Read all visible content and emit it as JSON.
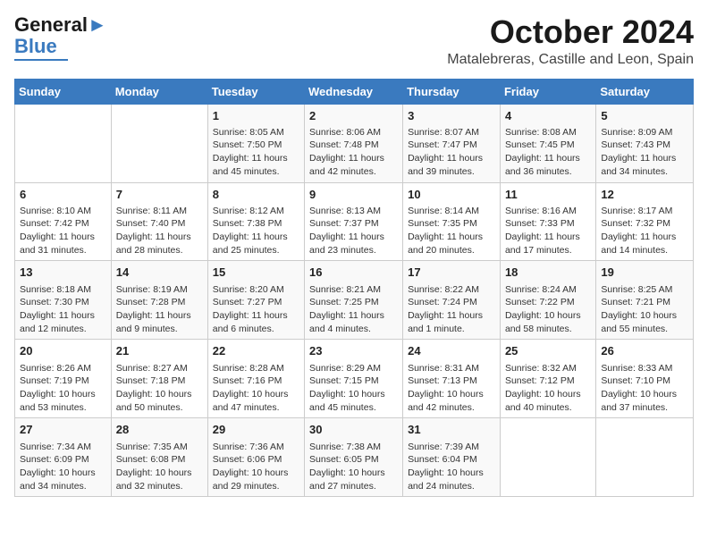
{
  "logo": {
    "line1": "General",
    "line2": "Blue"
  },
  "header": {
    "month": "October 2024",
    "location": "Matalebreras, Castille and Leon, Spain"
  },
  "days_of_week": [
    "Sunday",
    "Monday",
    "Tuesday",
    "Wednesday",
    "Thursday",
    "Friday",
    "Saturday"
  ],
  "weeks": [
    [
      {
        "day": "",
        "info": ""
      },
      {
        "day": "",
        "info": ""
      },
      {
        "day": "1",
        "info": "Sunrise: 8:05 AM\nSunset: 7:50 PM\nDaylight: 11 hours and 45 minutes."
      },
      {
        "day": "2",
        "info": "Sunrise: 8:06 AM\nSunset: 7:48 PM\nDaylight: 11 hours and 42 minutes."
      },
      {
        "day": "3",
        "info": "Sunrise: 8:07 AM\nSunset: 7:47 PM\nDaylight: 11 hours and 39 minutes."
      },
      {
        "day": "4",
        "info": "Sunrise: 8:08 AM\nSunset: 7:45 PM\nDaylight: 11 hours and 36 minutes."
      },
      {
        "day": "5",
        "info": "Sunrise: 8:09 AM\nSunset: 7:43 PM\nDaylight: 11 hours and 34 minutes."
      }
    ],
    [
      {
        "day": "6",
        "info": "Sunrise: 8:10 AM\nSunset: 7:42 PM\nDaylight: 11 hours and 31 minutes."
      },
      {
        "day": "7",
        "info": "Sunrise: 8:11 AM\nSunset: 7:40 PM\nDaylight: 11 hours and 28 minutes."
      },
      {
        "day": "8",
        "info": "Sunrise: 8:12 AM\nSunset: 7:38 PM\nDaylight: 11 hours and 25 minutes."
      },
      {
        "day": "9",
        "info": "Sunrise: 8:13 AM\nSunset: 7:37 PM\nDaylight: 11 hours and 23 minutes."
      },
      {
        "day": "10",
        "info": "Sunrise: 8:14 AM\nSunset: 7:35 PM\nDaylight: 11 hours and 20 minutes."
      },
      {
        "day": "11",
        "info": "Sunrise: 8:16 AM\nSunset: 7:33 PM\nDaylight: 11 hours and 17 minutes."
      },
      {
        "day": "12",
        "info": "Sunrise: 8:17 AM\nSunset: 7:32 PM\nDaylight: 11 hours and 14 minutes."
      }
    ],
    [
      {
        "day": "13",
        "info": "Sunrise: 8:18 AM\nSunset: 7:30 PM\nDaylight: 11 hours and 12 minutes."
      },
      {
        "day": "14",
        "info": "Sunrise: 8:19 AM\nSunset: 7:28 PM\nDaylight: 11 hours and 9 minutes."
      },
      {
        "day": "15",
        "info": "Sunrise: 8:20 AM\nSunset: 7:27 PM\nDaylight: 11 hours and 6 minutes."
      },
      {
        "day": "16",
        "info": "Sunrise: 8:21 AM\nSunset: 7:25 PM\nDaylight: 11 hours and 4 minutes."
      },
      {
        "day": "17",
        "info": "Sunrise: 8:22 AM\nSunset: 7:24 PM\nDaylight: 11 hours and 1 minute."
      },
      {
        "day": "18",
        "info": "Sunrise: 8:24 AM\nSunset: 7:22 PM\nDaylight: 10 hours and 58 minutes."
      },
      {
        "day": "19",
        "info": "Sunrise: 8:25 AM\nSunset: 7:21 PM\nDaylight: 10 hours and 55 minutes."
      }
    ],
    [
      {
        "day": "20",
        "info": "Sunrise: 8:26 AM\nSunset: 7:19 PM\nDaylight: 10 hours and 53 minutes."
      },
      {
        "day": "21",
        "info": "Sunrise: 8:27 AM\nSunset: 7:18 PM\nDaylight: 10 hours and 50 minutes."
      },
      {
        "day": "22",
        "info": "Sunrise: 8:28 AM\nSunset: 7:16 PM\nDaylight: 10 hours and 47 minutes."
      },
      {
        "day": "23",
        "info": "Sunrise: 8:29 AM\nSunset: 7:15 PM\nDaylight: 10 hours and 45 minutes."
      },
      {
        "day": "24",
        "info": "Sunrise: 8:31 AM\nSunset: 7:13 PM\nDaylight: 10 hours and 42 minutes."
      },
      {
        "day": "25",
        "info": "Sunrise: 8:32 AM\nSunset: 7:12 PM\nDaylight: 10 hours and 40 minutes."
      },
      {
        "day": "26",
        "info": "Sunrise: 8:33 AM\nSunset: 7:10 PM\nDaylight: 10 hours and 37 minutes."
      }
    ],
    [
      {
        "day": "27",
        "info": "Sunrise: 7:34 AM\nSunset: 6:09 PM\nDaylight: 10 hours and 34 minutes."
      },
      {
        "day": "28",
        "info": "Sunrise: 7:35 AM\nSunset: 6:08 PM\nDaylight: 10 hours and 32 minutes."
      },
      {
        "day": "29",
        "info": "Sunrise: 7:36 AM\nSunset: 6:06 PM\nDaylight: 10 hours and 29 minutes."
      },
      {
        "day": "30",
        "info": "Sunrise: 7:38 AM\nSunset: 6:05 PM\nDaylight: 10 hours and 27 minutes."
      },
      {
        "day": "31",
        "info": "Sunrise: 7:39 AM\nSunset: 6:04 PM\nDaylight: 10 hours and 24 minutes."
      },
      {
        "day": "",
        "info": ""
      },
      {
        "day": "",
        "info": ""
      }
    ]
  ]
}
